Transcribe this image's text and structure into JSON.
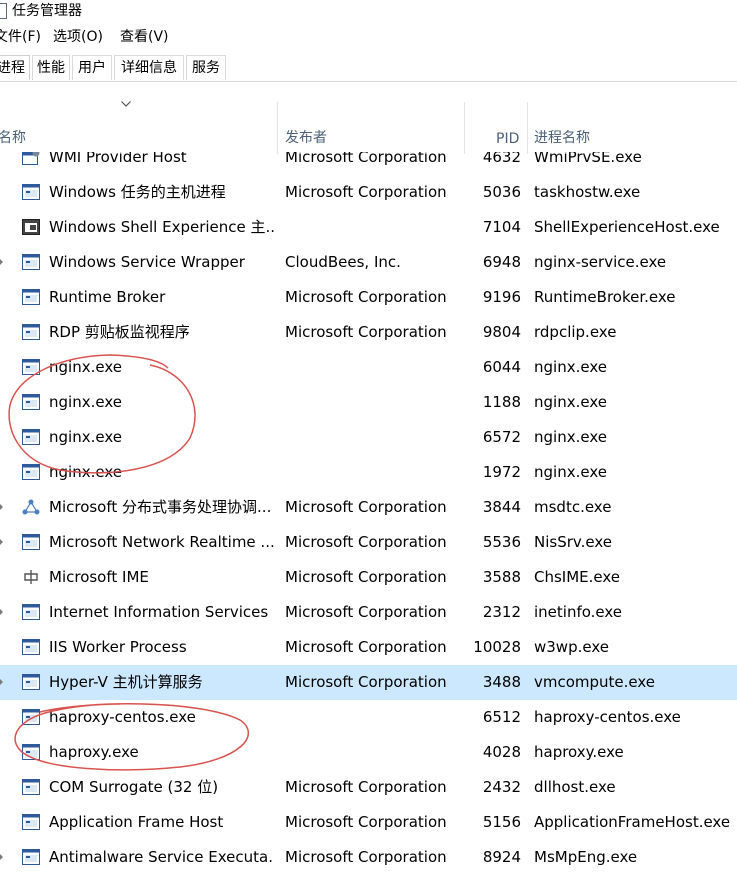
{
  "window": {
    "title": "任务管理器"
  },
  "menu": [
    {
      "label": "文件(F)"
    },
    {
      "label": "选项(O)"
    },
    {
      "label": "查看(V)"
    }
  ],
  "tabs": [
    {
      "label": "进程",
      "active": true
    },
    {
      "label": "性能"
    },
    {
      "label": "用户"
    },
    {
      "label": "详细信息"
    },
    {
      "label": "服务"
    }
  ],
  "columns": {
    "name": "名称",
    "publisher": "发布者",
    "pid": "PID",
    "process_name": "进程名称"
  },
  "rows": [
    {
      "name": "WMI Provider Host",
      "publisher": "Microsoft Corporation",
      "pid": "4632",
      "process_name": "WmiPrvSE.exe",
      "icon": "gear-window-icon"
    },
    {
      "name": "Windows 任务的主机进程",
      "publisher": "Microsoft Corporation",
      "pid": "5036",
      "process_name": "taskhostw.exe",
      "icon": "window-icon"
    },
    {
      "name": "Windows Shell Experience 主...",
      "publisher": "",
      "pid": "7104",
      "process_name": "ShellExperienceHost.exe",
      "icon": "shell-window-icon"
    },
    {
      "name": "Windows Service Wrapper",
      "publisher": "CloudBees, Inc.",
      "pid": "6948",
      "process_name": "nginx-service.exe",
      "icon": "window-icon",
      "expandable": true
    },
    {
      "name": "Runtime Broker",
      "publisher": "Microsoft Corporation",
      "pid": "9196",
      "process_name": "RuntimeBroker.exe",
      "icon": "window-icon"
    },
    {
      "name": "RDP 剪贴板监视程序",
      "publisher": "Microsoft Corporation",
      "pid": "9804",
      "process_name": "rdpclip.exe",
      "icon": "window-icon"
    },
    {
      "name": "nginx.exe",
      "publisher": "",
      "pid": "6044",
      "process_name": "nginx.exe",
      "icon": "window-icon"
    },
    {
      "name": "nginx.exe",
      "publisher": "",
      "pid": "1188",
      "process_name": "nginx.exe",
      "icon": "window-icon"
    },
    {
      "name": "nginx.exe",
      "publisher": "",
      "pid": "6572",
      "process_name": "nginx.exe",
      "icon": "window-icon"
    },
    {
      "name": "nginx.exe",
      "publisher": "",
      "pid": "1972",
      "process_name": "nginx.exe",
      "icon": "window-icon"
    },
    {
      "name": "Microsoft 分布式事务处理协调...",
      "publisher": "Microsoft Corporation",
      "pid": "3844",
      "process_name": "msdtc.exe",
      "icon": "network-icon",
      "expandable": true
    },
    {
      "name": "Microsoft Network Realtime ...",
      "publisher": "Microsoft Corporation",
      "pid": "5536",
      "process_name": "NisSrv.exe",
      "icon": "window-icon",
      "expandable": true
    },
    {
      "name": "Microsoft IME",
      "publisher": "Microsoft Corporation",
      "pid": "3588",
      "process_name": "ChsIME.exe",
      "icon": "ime-icon"
    },
    {
      "name": "Internet Information Services",
      "publisher": "Microsoft Corporation",
      "pid": "2312",
      "process_name": "inetinfo.exe",
      "icon": "window-icon",
      "expandable": true
    },
    {
      "name": "IIS Worker Process",
      "publisher": "Microsoft Corporation",
      "pid": "10028",
      "process_name": "w3wp.exe",
      "icon": "window-icon"
    },
    {
      "name": "Hyper-V 主机计算服务",
      "publisher": "Microsoft Corporation",
      "pid": "3488",
      "process_name": "vmcompute.exe",
      "icon": "window-icon",
      "expandable": true,
      "selected": true
    },
    {
      "name": "haproxy-centos.exe",
      "publisher": "",
      "pid": "6512",
      "process_name": "haproxy-centos.exe",
      "icon": "window-icon"
    },
    {
      "name": "haproxy.exe",
      "publisher": "",
      "pid": "4028",
      "process_name": "haproxy.exe",
      "icon": "window-icon"
    },
    {
      "name": "COM Surrogate (32 位)",
      "publisher": "Microsoft Corporation",
      "pid": "2432",
      "process_name": "dllhost.exe",
      "icon": "window-icon"
    },
    {
      "name": "Application Frame Host",
      "publisher": "Microsoft Corporation",
      "pid": "5156",
      "process_name": "ApplicationFrameHost.exe",
      "icon": "window-icon"
    },
    {
      "name": "Antimalware Service Executa...",
      "publisher": "Microsoft Corporation",
      "pid": "8924",
      "process_name": "MsMpEng.exe",
      "icon": "window-icon",
      "expandable": true
    }
  ],
  "colors": {
    "selected_row": "#cce8ff",
    "header_text": "#4c607a",
    "annotation": "#d9534f"
  }
}
